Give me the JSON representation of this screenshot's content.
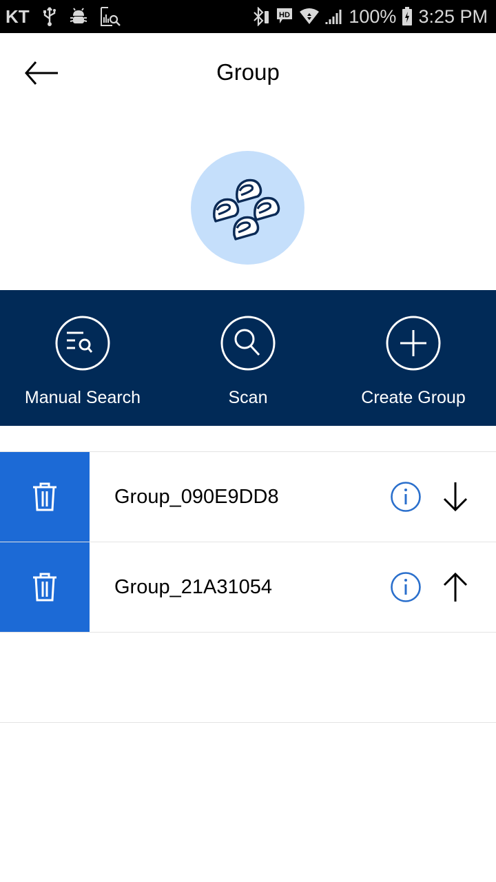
{
  "status_bar": {
    "carrier": "KT",
    "left_icons": [
      "usb-icon",
      "debug-bug-icon",
      "analytics-search-icon"
    ],
    "right_icons": [
      "bluetooth-icon",
      "hd-voice-icon",
      "wifi-icon",
      "signal-icon",
      "battery-charging-icon"
    ],
    "battery": "100%",
    "time": "3:25 PM"
  },
  "header": {
    "title": "Group",
    "back_icon": "arrow-left-icon"
  },
  "avatar": {
    "icon": "helmets-group-icon",
    "background": "#c5dffb",
    "stroke": "#0b2a55"
  },
  "actions": [
    {
      "label": "Manual Search",
      "icon": "list-search-icon"
    },
    {
      "label": "Scan",
      "icon": "search-icon"
    },
    {
      "label": "Create Group",
      "icon": "plus-circle-icon"
    }
  ],
  "groups": [
    {
      "name": "Group_090E9DD8",
      "move_direction": "down"
    },
    {
      "name": "Group_21A31054",
      "move_direction": "up"
    }
  ],
  "colors": {
    "action_bar_bg": "#012a57",
    "delete_bg": "#1c6ad6",
    "info_icon": "#2a6fcc"
  }
}
